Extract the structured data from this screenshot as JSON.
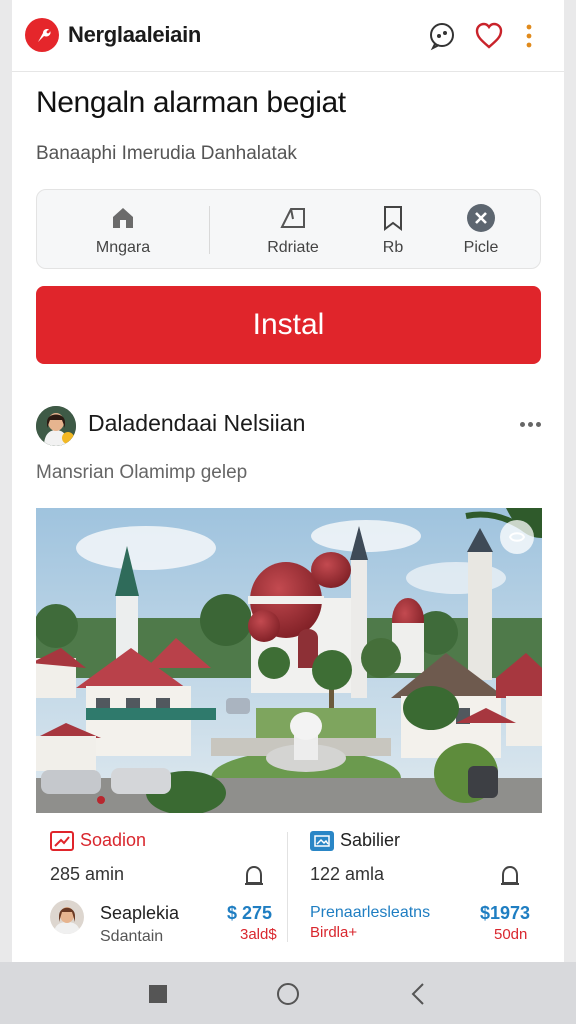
{
  "header": {
    "app_title": "Nerglaaleiain",
    "icons": [
      "app-logo-icon",
      "chat-icon",
      "heart-icon",
      "more-vertical-icon"
    ]
  },
  "page": {
    "title": "Nengaln alarman begiat",
    "subtitle": "Banaaphi Imerudia Danhalatak"
  },
  "actions": [
    {
      "label": "Mngara",
      "icon": "home-icon"
    },
    {
      "label": "Rdriate",
      "icon": "tag-icon"
    },
    {
      "label": "Rb",
      "icon": "bookmark-icon"
    },
    {
      "label": "Picle",
      "icon": "close-circle-icon"
    }
  ],
  "install": {
    "label": "Instal"
  },
  "post": {
    "author": "Daladendaai Nelsiian",
    "caption": "Mansrian Olamimp gelep"
  },
  "listings": [
    {
      "title": "Soadion",
      "meta": "285 amin",
      "seller": "Seaplekia",
      "seller_sub": "Sdantain",
      "price": "$ 275",
      "price_sub": "3ald$",
      "badge_color": "#e0252b"
    },
    {
      "title": "Sabilier",
      "meta": "122 amla",
      "seller": "Prenaarlesleatns",
      "seller_sub": "Birdla+",
      "price": "$1973",
      "price_sub": "50dn",
      "badge_color": "#2a86c6"
    }
  ],
  "colors": {
    "accent": "#e0252b",
    "price": "#1f7ec2",
    "background": "#ffffff",
    "navbar": "#d8d9dc"
  }
}
